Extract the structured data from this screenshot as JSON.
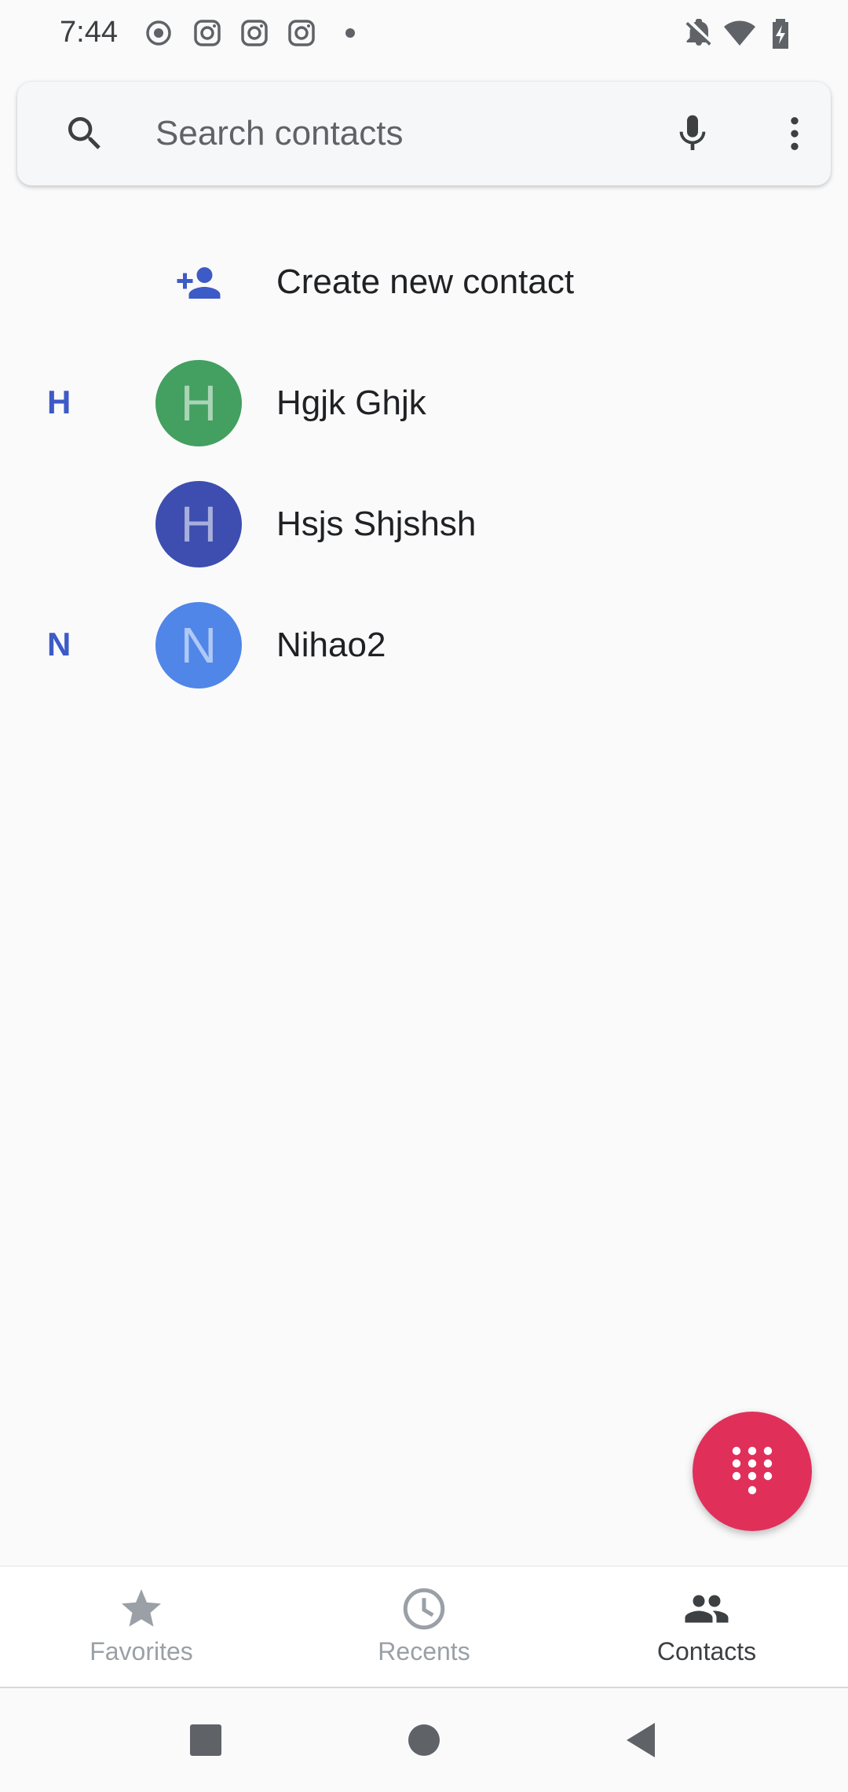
{
  "status_bar": {
    "time": "7:44",
    "notification_icons": [
      "record-icon",
      "instagram-icon",
      "instagram-icon",
      "instagram-icon",
      "dot-icon"
    ],
    "right_icons": [
      "bell-off-icon",
      "wifi-icon",
      "battery-charging-icon"
    ]
  },
  "search": {
    "placeholder": "Search contacts"
  },
  "list": {
    "create_new_label": "Create new contact",
    "contacts": [
      {
        "section": "H",
        "initial": "H",
        "name": "Hgjk Ghjk",
        "avatar_color": "#43a060"
      },
      {
        "section": "",
        "initial": "H",
        "name": "Hsjs Shjshsh",
        "avatar_color": "#3d4eb0"
      },
      {
        "section": "N",
        "initial": "N",
        "name": "Nihao2",
        "avatar_color": "#5086e8"
      }
    ]
  },
  "fab": {
    "icon": "dialpad-icon",
    "color": "#e0305a"
  },
  "bottom_nav": {
    "tabs": [
      {
        "label": "Favorites",
        "icon": "star-icon",
        "active": false
      },
      {
        "label": "Recents",
        "icon": "clock-icon",
        "active": false
      },
      {
        "label": "Contacts",
        "icon": "people-icon",
        "active": true
      }
    ]
  },
  "colors": {
    "accent": "#3d5bc6",
    "background": "#fafafa"
  }
}
